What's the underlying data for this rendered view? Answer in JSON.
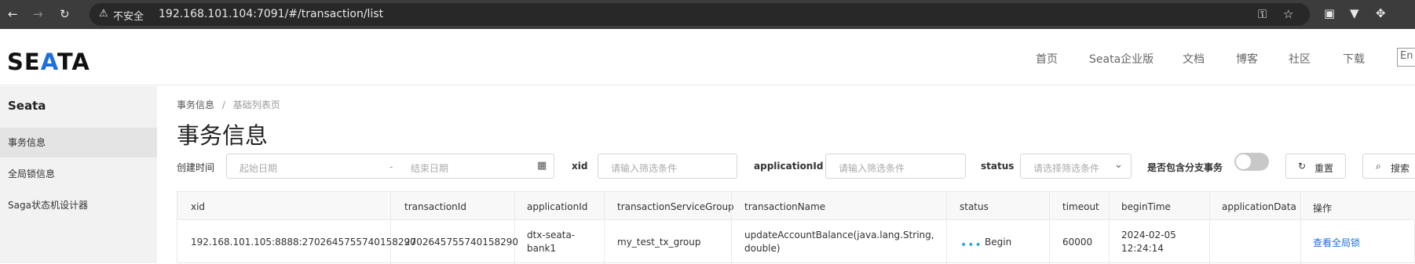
{
  "browser": {
    "security_warning": "不安全",
    "url": "192.168.101.104:7091/#/transaction/list",
    "icons": [
      "back-icon",
      "forward-icon",
      "reload-icon",
      "warning-icon",
      "key-icon",
      "star-icon",
      "extension-icon",
      "vpn-icon",
      "puzzle-icon"
    ]
  },
  "header": {
    "logo_prefix": "SE",
    "logo_accent": "A",
    "logo_suffix": "TA",
    "nav": [
      "首页",
      "Seata企业版",
      "文档",
      "博客",
      "社区",
      "下载"
    ],
    "lang": "En"
  },
  "sidebar": {
    "title": "Seata",
    "items": [
      {
        "label": "事务信息",
        "active": true
      },
      {
        "label": "全局锁信息",
        "active": false
      },
      {
        "label": "Saga状态机设计器",
        "active": false
      }
    ]
  },
  "breadcrumb": {
    "first": "事务信息",
    "sep": "/",
    "current": "基础列表页"
  },
  "page_title": "事务信息",
  "filters": {
    "create_time_label": "创建时间",
    "start_placeholder": "起始日期",
    "range_sep": "-",
    "end_placeholder": "结束日期",
    "xid_label": "xid",
    "xid_placeholder": "请输入筛选条件",
    "app_label": "applicationId",
    "app_placeholder": "请输入筛选条件",
    "status_label": "status",
    "status_placeholder": "请选择筛选条件",
    "branch_label": "是否包含分支事务",
    "branch_toggle": false,
    "reset_label": "重置",
    "search_label": "搜索"
  },
  "table": {
    "columns": [
      "xid",
      "transactionId",
      "applicationId",
      "transactionServiceGroup",
      "transactionName",
      "status",
      "timeout",
      "beginTime",
      "applicationData",
      "操作"
    ],
    "rows": [
      {
        "xid": "192.168.101.105:8888:2702645755740158290",
        "transactionId": "2702645755740158290",
        "applicationId_l1": "dtx-seata-",
        "applicationId_l2": "bank1",
        "transactionServiceGroup": "my_test_tx_group",
        "transactionName_l1": "updateAccountBalance(java.lang.String,",
        "transactionName_l2": "double)",
        "status": "Begin",
        "timeout": "60000",
        "beginTime_l1": "2024-02-05",
        "beginTime_l2": "12:24:14",
        "applicationData": "",
        "action": "查看全局锁"
      }
    ]
  },
  "colors": {
    "accent": "#1e6fd9",
    "status_dot": "#2aa8d8",
    "chrome": "#3c3c3c"
  }
}
